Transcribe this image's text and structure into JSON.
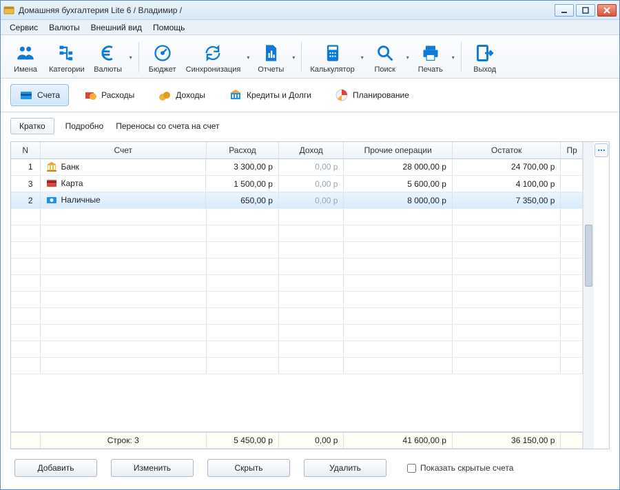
{
  "window": {
    "title": "Домашняя бухгалтерия Lite 6  / Владимир /"
  },
  "menu": {
    "items": [
      "Сервис",
      "Валюты",
      "Внешний вид",
      "Помощь"
    ]
  },
  "toolbar": {
    "names": {
      "label": "Имена"
    },
    "categories": {
      "label": "Категории"
    },
    "currencies": {
      "label": "Валюты"
    },
    "budget": {
      "label": "Бюджет"
    },
    "sync": {
      "label": "Синхронизация"
    },
    "reports": {
      "label": "Отчеты"
    },
    "calc": {
      "label": "Калькулятор"
    },
    "search": {
      "label": "Поиск"
    },
    "print": {
      "label": "Печать"
    },
    "exit": {
      "label": "Выход"
    }
  },
  "sections": {
    "accounts": "Счета",
    "expenses": "Расходы",
    "income": "Доходы",
    "credits": "Кредиты и Долги",
    "planning": "Планирование"
  },
  "views": {
    "brief": "Кратко",
    "detailed": "Подробно",
    "transfers": "Переносы со счета на счет"
  },
  "columns": {
    "n": "N",
    "account": "Счет",
    "expense": "Расход",
    "income": "Доход",
    "other": "Прочие операции",
    "balance": "Остаток",
    "extra": "Пр"
  },
  "rows": [
    {
      "n": "1",
      "acct": "Банк",
      "icon": "bank",
      "exp": "3 300,00 р",
      "inc": "0,00 р",
      "oth": "28 000,00 р",
      "bal": "24 700,00 р",
      "sel": false
    },
    {
      "n": "3",
      "acct": "Карта",
      "icon": "card",
      "exp": "1 500,00 р",
      "inc": "0,00 р",
      "oth": "5 600,00 р",
      "bal": "4 100,00 р",
      "sel": false
    },
    {
      "n": "2",
      "acct": "Наличные",
      "icon": "cash",
      "exp": "650,00 р",
      "inc": "0,00 р",
      "oth": "8 000,00 р",
      "bal": "7 350,00 р",
      "sel": true
    }
  ],
  "footer": {
    "rows_label": "Строк: 3",
    "exp": "5 450,00 р",
    "inc": "0,00 р",
    "oth": "41 600,00 р",
    "bal": "36 150,00 р"
  },
  "buttons": {
    "add": "Добавить",
    "edit": "Изменить",
    "hide": "Скрыть",
    "delete": "Удалить",
    "show_hidden": "Показать скрытые счета"
  }
}
